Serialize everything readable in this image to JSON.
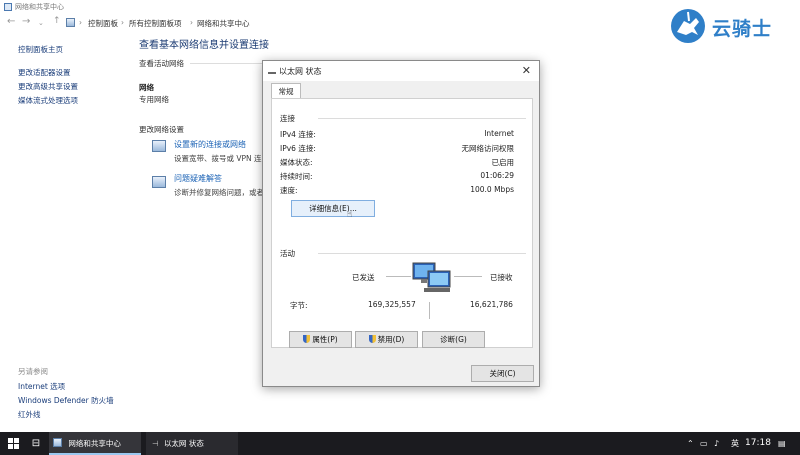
{
  "window": {
    "title": "网络和共享中心"
  },
  "address": {
    "crumbs": [
      "控制面板",
      "所有控制面板项",
      "网络和共享中心"
    ]
  },
  "sidebar": {
    "home": "控制面板主页",
    "links": [
      "更改适配器设置",
      "更改高级共享设置",
      "媒体流式处理选项"
    ],
    "see_also_title": "另请参阅",
    "see_also": [
      "Internet 选项",
      "Windows Defender 防火墙",
      "红外线"
    ]
  },
  "main": {
    "title": "查看基本网络信息并设置连接",
    "active_label": "查看活动网络",
    "network_name": "网络",
    "network_type": "专用网络",
    "change_label": "更改网络设置",
    "tasks": [
      {
        "link": "设置新的连接或网络",
        "desc": "设置宽带、拨号或 VPN 连"
      },
      {
        "link": "问题疑难解答",
        "desc": "诊断并修复网络问题，或者"
      }
    ]
  },
  "dialog": {
    "title": "以太网 状态",
    "close": "✕",
    "tab": "常规",
    "connection_label": "连接",
    "rows": [
      {
        "k": "IPv4 连接:",
        "v": "Internet"
      },
      {
        "k": "IPv6 连接:",
        "v": "无网络访问权限"
      },
      {
        "k": "媒体状态:",
        "v": "已启用"
      },
      {
        "k": "持续时间:",
        "v": "01:06:29"
      },
      {
        "k": "速度:",
        "v": "100.0 Mbps"
      }
    ],
    "details_button": "详细信息(E)...",
    "activity_label": "活动",
    "sent_label": "已发送",
    "received_label": "已接收",
    "bytes_label": "字节:",
    "bytes_sent": "169,325,557",
    "bytes_received": "16,621,786",
    "properties_button": "属性(P)",
    "disable_button": "禁用(D)",
    "diagnose_button": "诊断(G)",
    "close_button": "关闭(C)"
  },
  "taskbar": {
    "items": [
      "网络和共享中心",
      "以太网 状态"
    ],
    "ime": "英",
    "time": "17:18"
  },
  "logo": {
    "text": "云骑士"
  },
  "colors": {
    "link": "#1a62b5",
    "title": "#1a3a72",
    "accent": "#0078d7"
  }
}
